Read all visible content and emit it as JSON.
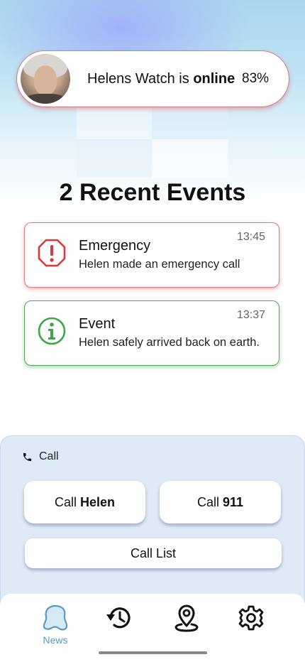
{
  "header": {
    "status_prefix": "Helens Watch is",
    "status_value": "online",
    "battery": "83%"
  },
  "events": {
    "title": "2 Recent Events",
    "items": [
      {
        "type": "emergency",
        "icon": "alert-octagon-icon",
        "title": "Emergency",
        "description": "Helen made an emergency call",
        "time": "13:45",
        "color": "#d9363e"
      },
      {
        "type": "event",
        "icon": "info-circle-icon",
        "title": "Event",
        "description": "Helen safely arrived back on earth.",
        "time": "13:37",
        "color": "#3aa845"
      }
    ]
  },
  "call": {
    "header": "Call",
    "call_prefix": "Call",
    "helen_label": "Helen",
    "emergency_label": "911",
    "call_list_label": "Call List"
  },
  "nav": {
    "items": [
      {
        "name": "news",
        "label": "News",
        "icon": "news-blob-icon",
        "active": true
      },
      {
        "name": "history",
        "label": "",
        "icon": "history-icon",
        "active": false
      },
      {
        "name": "location",
        "label": "",
        "icon": "map-pin-icon",
        "active": false
      },
      {
        "name": "settings",
        "label": "",
        "icon": "gear-icon",
        "active": false
      }
    ],
    "active_color": "#5b9bbd"
  }
}
